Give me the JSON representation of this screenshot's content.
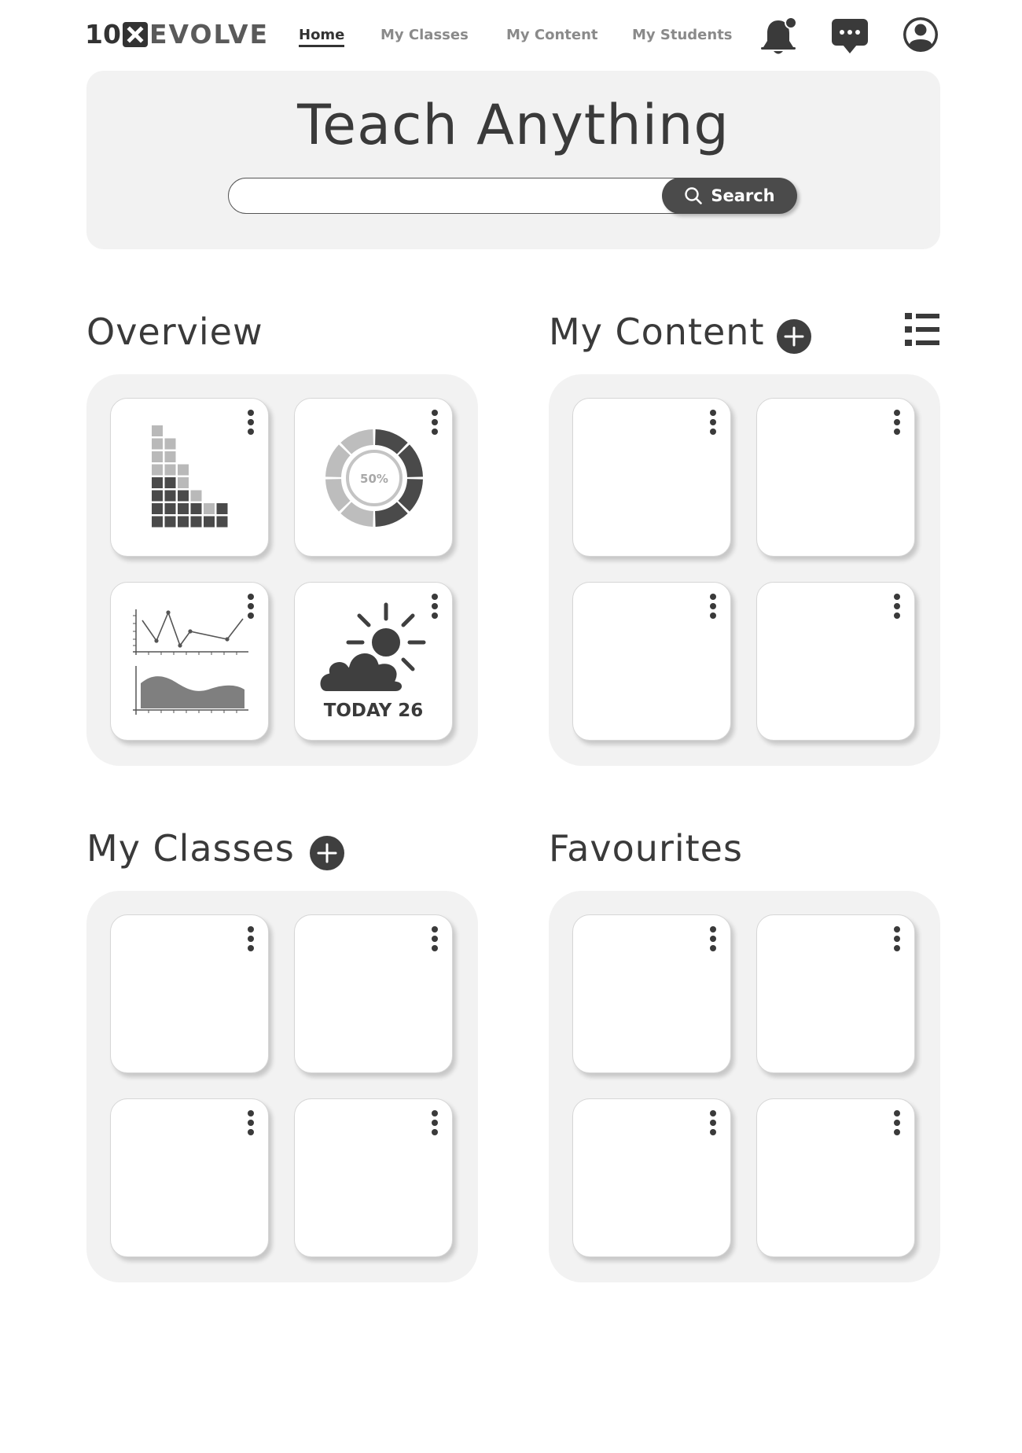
{
  "logo": {
    "num": "10",
    "word": "EVOLVE"
  },
  "nav": {
    "links": [
      {
        "label": "Home",
        "active": true
      },
      {
        "label": "My Classes",
        "active": false
      },
      {
        "label": "My Content",
        "active": false
      },
      {
        "label": "My Students",
        "active": false
      }
    ],
    "icons": [
      "bell-icon",
      "chat-icon",
      "user-avatar-icon"
    ]
  },
  "hero": {
    "title": "Teach Anything",
    "search_value": "",
    "search_label": "Search"
  },
  "sections": {
    "overview": {
      "title": "Overview"
    },
    "my_content": {
      "title": "My Content"
    },
    "my_classes": {
      "title": "My Classes"
    },
    "favourites": {
      "title": "Favourites"
    }
  },
  "overview_widgets": {
    "donut_label": "50%",
    "weather_label": "TODAY 26"
  },
  "colors": {
    "dark": "#3f3f3f",
    "panel": "#f2f2f2",
    "muted": "#8a8a8a"
  }
}
